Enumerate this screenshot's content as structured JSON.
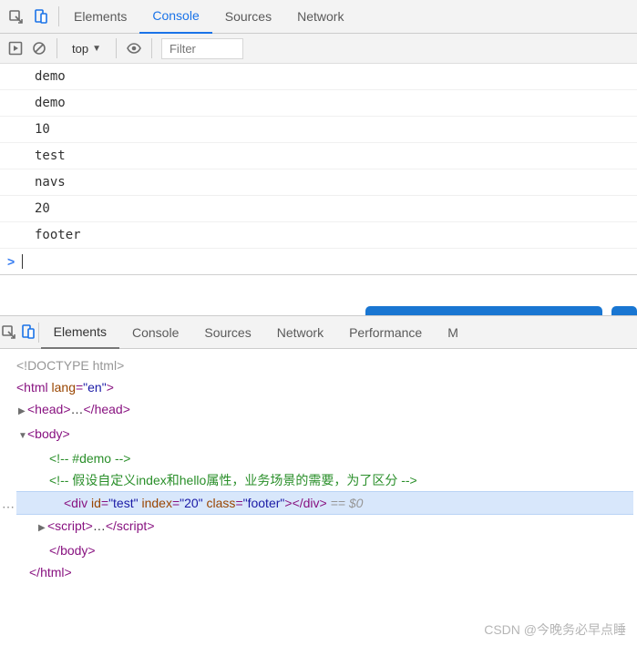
{
  "top": {
    "tabs": [
      "Elements",
      "Console",
      "Sources",
      "Network"
    ],
    "active_index": 1,
    "context_label": "top",
    "filter_placeholder": "Filter"
  },
  "console": {
    "rows": [
      "demo",
      "demo",
      "10",
      "test",
      "navs",
      "20",
      "footer"
    ]
  },
  "bottom": {
    "tabs": [
      "Elements",
      "Console",
      "Sources",
      "Network",
      "Performance",
      "M"
    ],
    "active_index": 0
  },
  "elements_src": {
    "doctype": "<!DOCTYPE html>",
    "html_open_pre": "<html ",
    "html_attr": "lang",
    "html_val": "\"en\"",
    "html_open_post": ">",
    "head_open": "<head>",
    "head_ellipsis": "…",
    "head_close": "</head>",
    "body_open": "<body>",
    "comment1": "<!-- #demo -->",
    "comment2": "<!-- 假设自定义index和hello属性，业务场景的需要，为了区分 -->",
    "div_open": "<div ",
    "div_attr_id": "id",
    "div_val_id": "\"test\"",
    "div_attr_index": "index",
    "div_val_index": "\"20\"",
    "div_attr_class": "class",
    "div_val_class": "\"footer\"",
    "div_mid": ">",
    "div_close": "</div>",
    "eq0": " == $0",
    "script_open": "<script>",
    "script_ellipsis": "…",
    "script_close": "</script>",
    "body_close": "</body>",
    "html_close": "</html>"
  },
  "watermark": "CSDN @今晚务必早点睡"
}
